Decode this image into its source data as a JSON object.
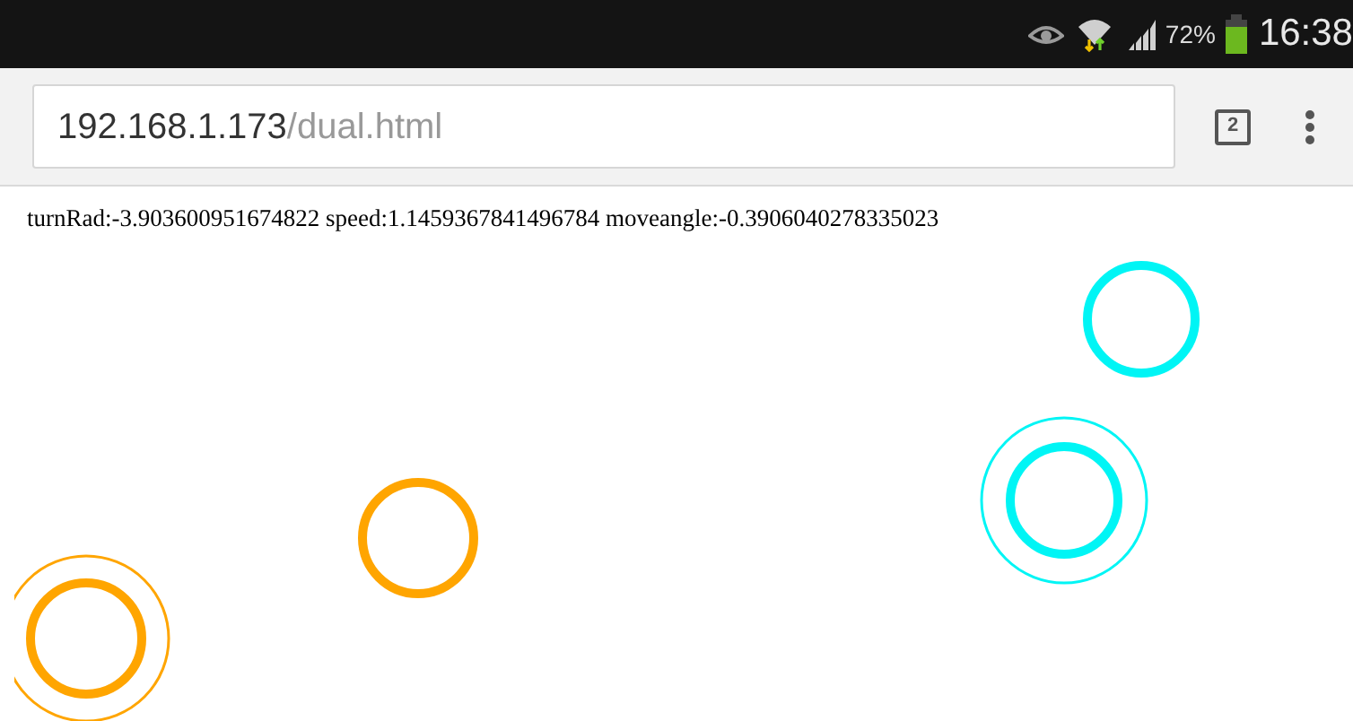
{
  "status_bar": {
    "battery": "72%",
    "time": "16:38"
  },
  "address_bar": {
    "host": "192.168.1.173",
    "path": "/dual.html",
    "tab_count": "2"
  },
  "readout": "turnRad:-3.903600951674822 speed:1.1459367841496784 moveangle:-0.3906040278335023"
}
